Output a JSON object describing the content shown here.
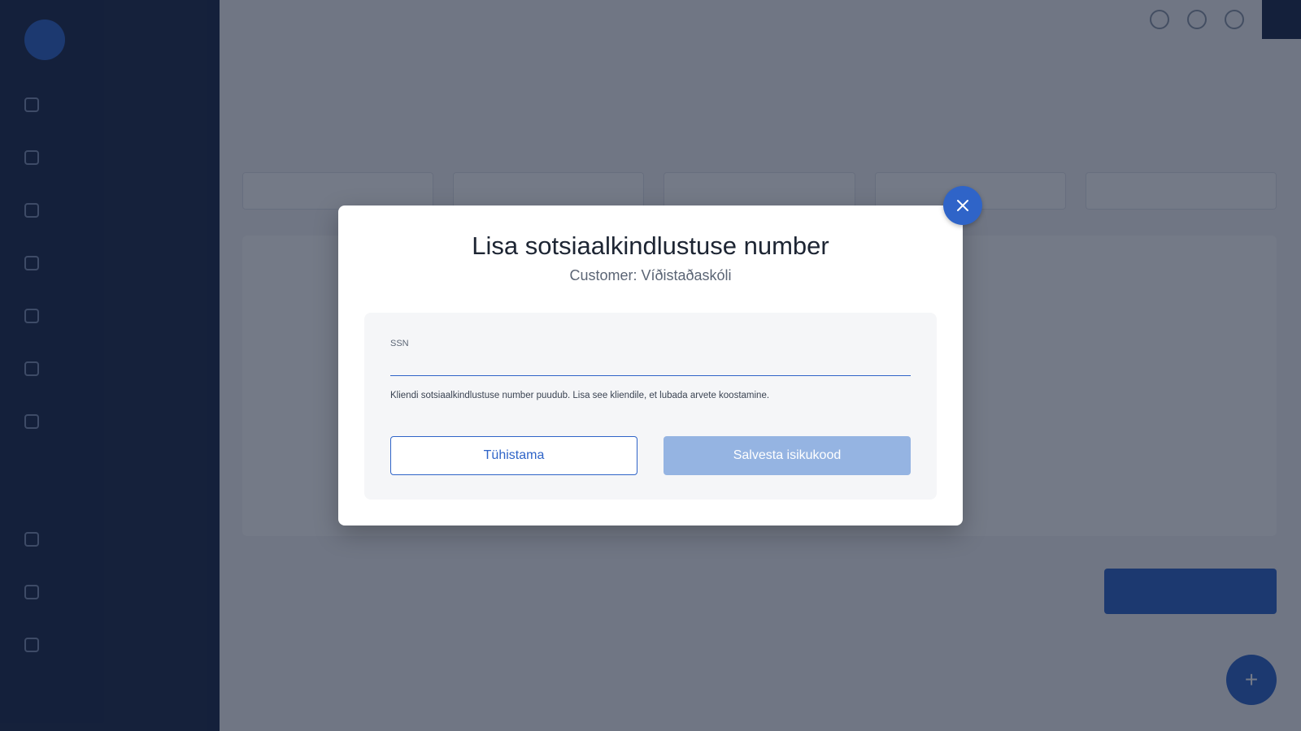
{
  "background": {
    "user": {
      "initial": "",
      "name": "",
      "role": ""
    },
    "nav": [
      "",
      "",
      "",
      "",
      "",
      "",
      "",
      "",
      "",
      ""
    ],
    "page_title": "",
    "tabs": [],
    "filters": [
      "",
      "",
      "",
      "",
      ""
    ],
    "summary": ""
  },
  "modal": {
    "title": "Lisa sotsiaalkindlustuse number",
    "subtitle": "Customer: Víðistaðaskóli",
    "close_icon": "close-icon",
    "ssn": {
      "label": "SSN",
      "value": "",
      "placeholder": "",
      "helper": "Kliendi sotsiaalkindlustuse number puudub. Lisa see kliendile, et lubada arvete koostamine."
    },
    "cancel_label": "Tühistama",
    "save_label": "Salvesta isikukood"
  },
  "colors": {
    "primary": "#2f64c8",
    "primary_disabled": "#95b4e2",
    "sidebar": "#1b2a4a"
  }
}
